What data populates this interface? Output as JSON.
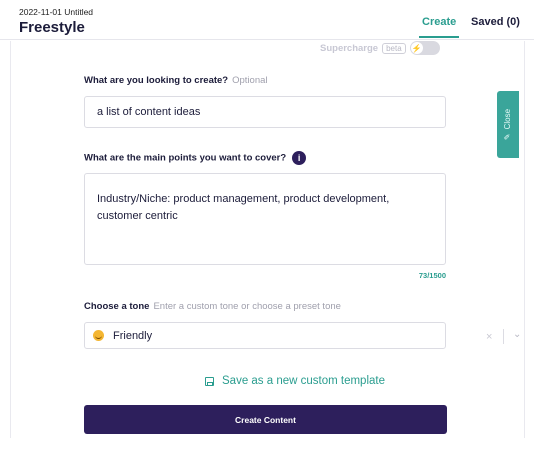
{
  "header": {
    "doc_meta": "2022-11-01 Untitled",
    "title": "Freestyle",
    "tabs": {
      "create": "Create",
      "saved": "Saved (0)"
    }
  },
  "supercharge": {
    "label": "Supercharge",
    "badge": "beta",
    "toggle_icon": "lightning-icon",
    "enabled": false
  },
  "form": {
    "topic": {
      "label": "What are you looking to create?",
      "hint": "Optional",
      "value": "a list of content ideas"
    },
    "points": {
      "label": "What are the main points you want to cover?",
      "info_icon": "i",
      "value": "Industry/Niche: product management, product development, customer centric",
      "counter": "73/1500"
    },
    "tone": {
      "label": "Choose a tone",
      "hint": "Enter a custom tone or choose a preset tone",
      "selected": "Friendly",
      "emoji_icon": "smiley-icon",
      "clear_icon": "×",
      "chevron_icon": "⌄"
    },
    "save_template": "Save as a new custom template",
    "create_button": "Create Content"
  },
  "close_tab": {
    "label": "Close",
    "icon": "pencil-icon"
  },
  "colors": {
    "accent": "#2a9d8f",
    "primary": "#2d1f5c",
    "close_tab": "#3aa59a"
  }
}
